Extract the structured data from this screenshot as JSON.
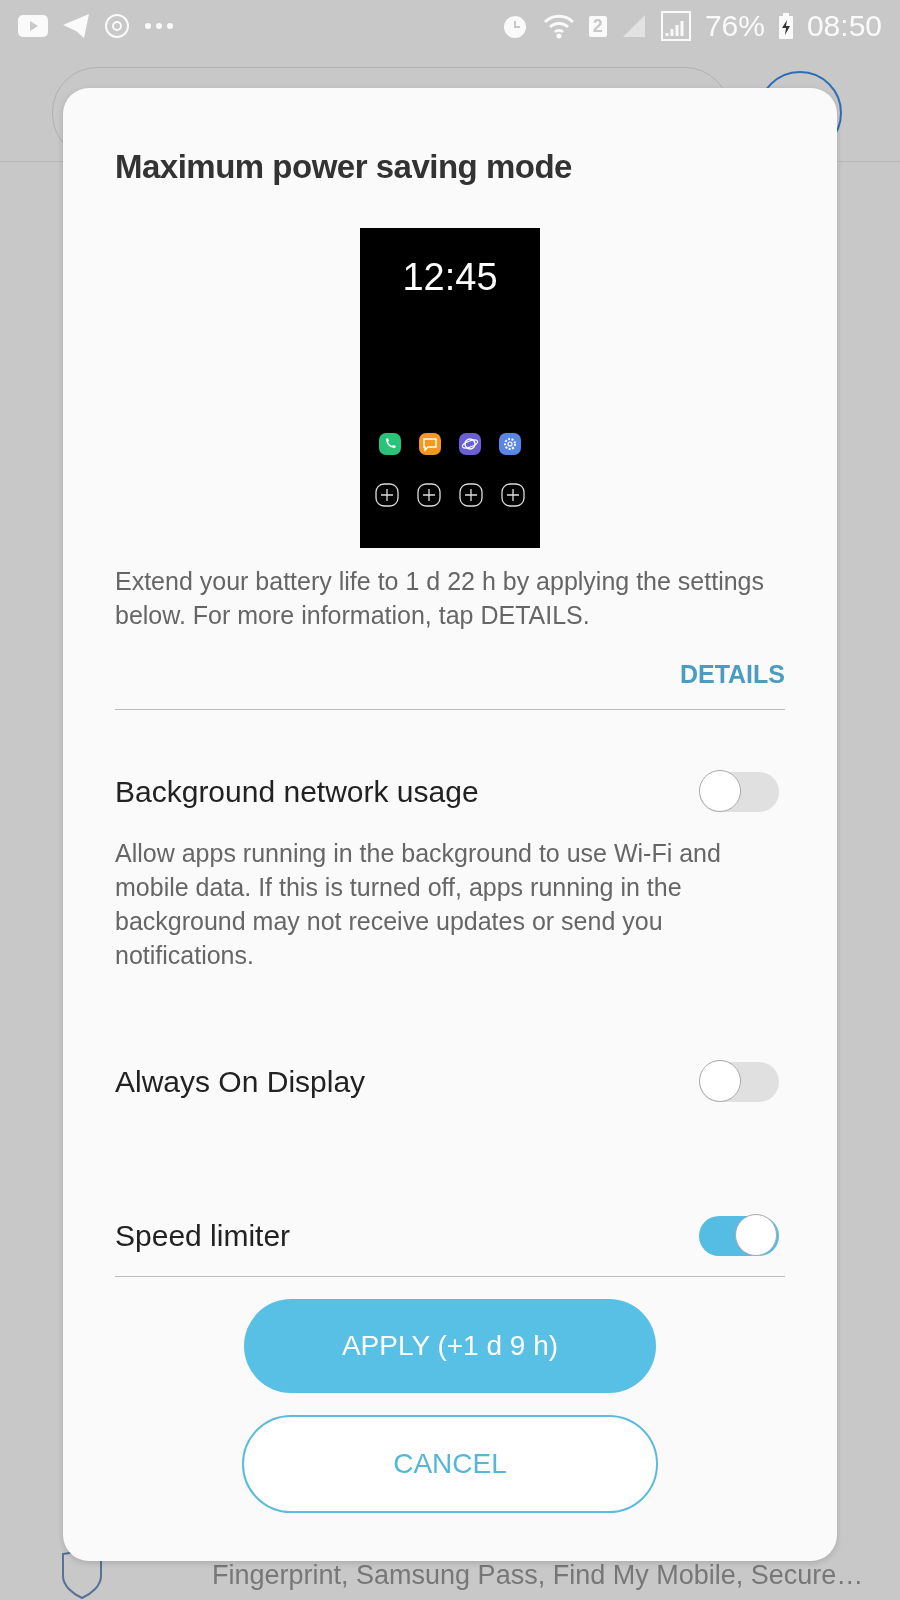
{
  "status_bar": {
    "sim_badge": "2",
    "battery": "76%",
    "time": "08:50"
  },
  "background": {
    "footer_text": "Fingerprint, Samsung Pass, Find My Mobile, Secure…"
  },
  "dialog": {
    "title": "Maximum power saving mode",
    "preview": {
      "clock": "12:45"
    },
    "description": "Extend your battery life to 1 d 22 h by applying the settings below. For more information, tap DETAILS.",
    "details_link": "DETAILS",
    "settings": [
      {
        "label": "Background network usage",
        "description": "Allow apps running in the background to use Wi-Fi and mobile data. If this is turned off, apps running in the background may not receive updates or send you notifications.",
        "on": false
      },
      {
        "label": "Always On Display",
        "on": false
      },
      {
        "label": "Speed limiter",
        "on": true
      }
    ],
    "buttons": [
      {
        "kind": "primary",
        "label": "APPLY (+1 d 9 h)"
      },
      {
        "kind": "outline",
        "label": "CANCEL"
      }
    ]
  }
}
